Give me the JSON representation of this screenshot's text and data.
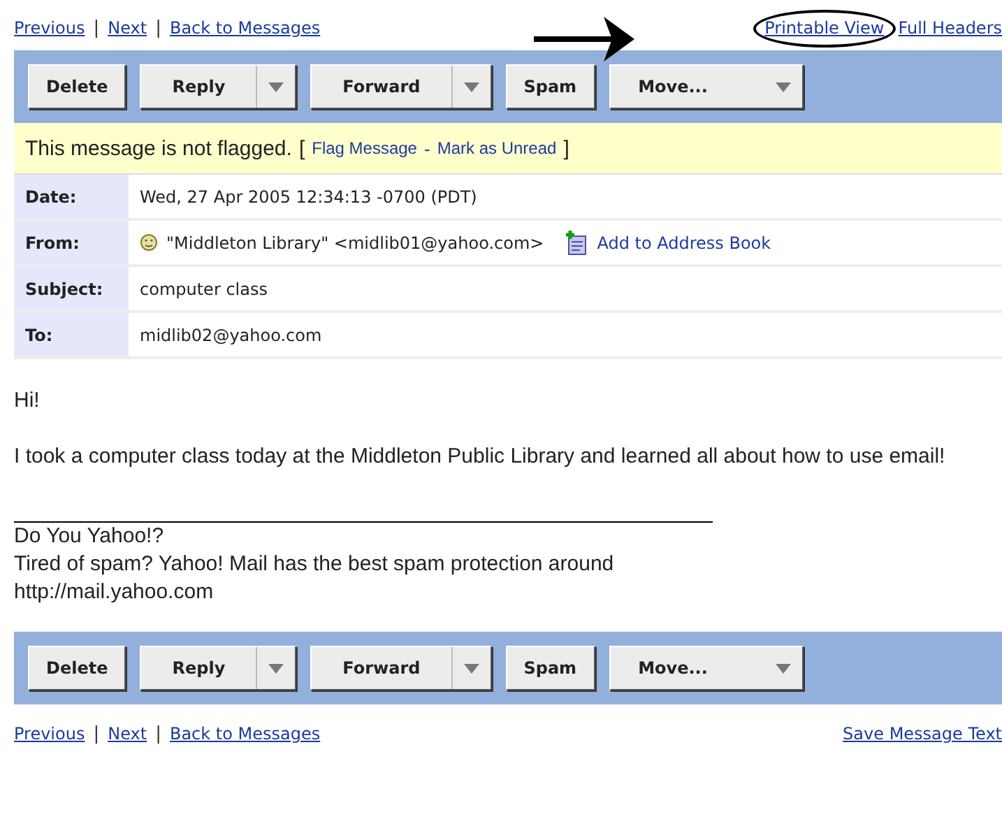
{
  "top_nav": {
    "separator": "|",
    "left_links": [
      "Previous",
      "Next",
      "Back to Messages"
    ],
    "right_links": [
      {
        "label": "Printable View",
        "circled": true
      },
      {
        "label": "Full Headers",
        "circled": false
      }
    ]
  },
  "toolbar_top": [
    {
      "label": "Delete",
      "kind": "plain"
    },
    {
      "label": "Reply",
      "kind": "split"
    },
    {
      "label": "Forward",
      "kind": "split"
    },
    {
      "label": "Spam",
      "kind": "plain"
    },
    {
      "label": "Move...",
      "kind": "menu"
    }
  ],
  "flag_bar": {
    "text": "This message is not flagged.",
    "open": "[",
    "links": [
      "Flag Message",
      "Mark as Unread"
    ],
    "separator": "-",
    "close": "]"
  },
  "headers": [
    {
      "label": "Date:",
      "value": "Wed, 27 Apr 2005 12:34:13 -0700 (PDT)",
      "kind": "text"
    },
    {
      "label": "From:",
      "value": "\"Middleton Library\" <midlib01@yahoo.com>",
      "kind": "sender",
      "action": "Add to Address Book"
    },
    {
      "label": "Subject:",
      "value": "computer class",
      "kind": "text"
    },
    {
      "label": "To:",
      "value": "midlib02@yahoo.com",
      "kind": "text"
    }
  ],
  "body": {
    "paragraphs": [
      "Hi!",
      "I took a computer class today at the Middleton Public Library and learned all about how to use email!"
    ],
    "signature": [
      "Do You Yahoo!?",
      "Tired of spam? Yahoo! Mail has the best spam protection around",
      "http://mail.yahoo.com"
    ]
  },
  "toolbar_bottom": [
    {
      "label": "Delete",
      "kind": "plain"
    },
    {
      "label": "Reply",
      "kind": "split"
    },
    {
      "label": "Forward",
      "kind": "split"
    },
    {
      "label": "Spam",
      "kind": "plain"
    },
    {
      "label": "Move...",
      "kind": "menu"
    }
  ],
  "bottom_nav": {
    "separator": "|",
    "left_links": [
      "Previous",
      "Next",
      "Back to Messages"
    ],
    "right_links": [
      "Save Message Text"
    ]
  }
}
